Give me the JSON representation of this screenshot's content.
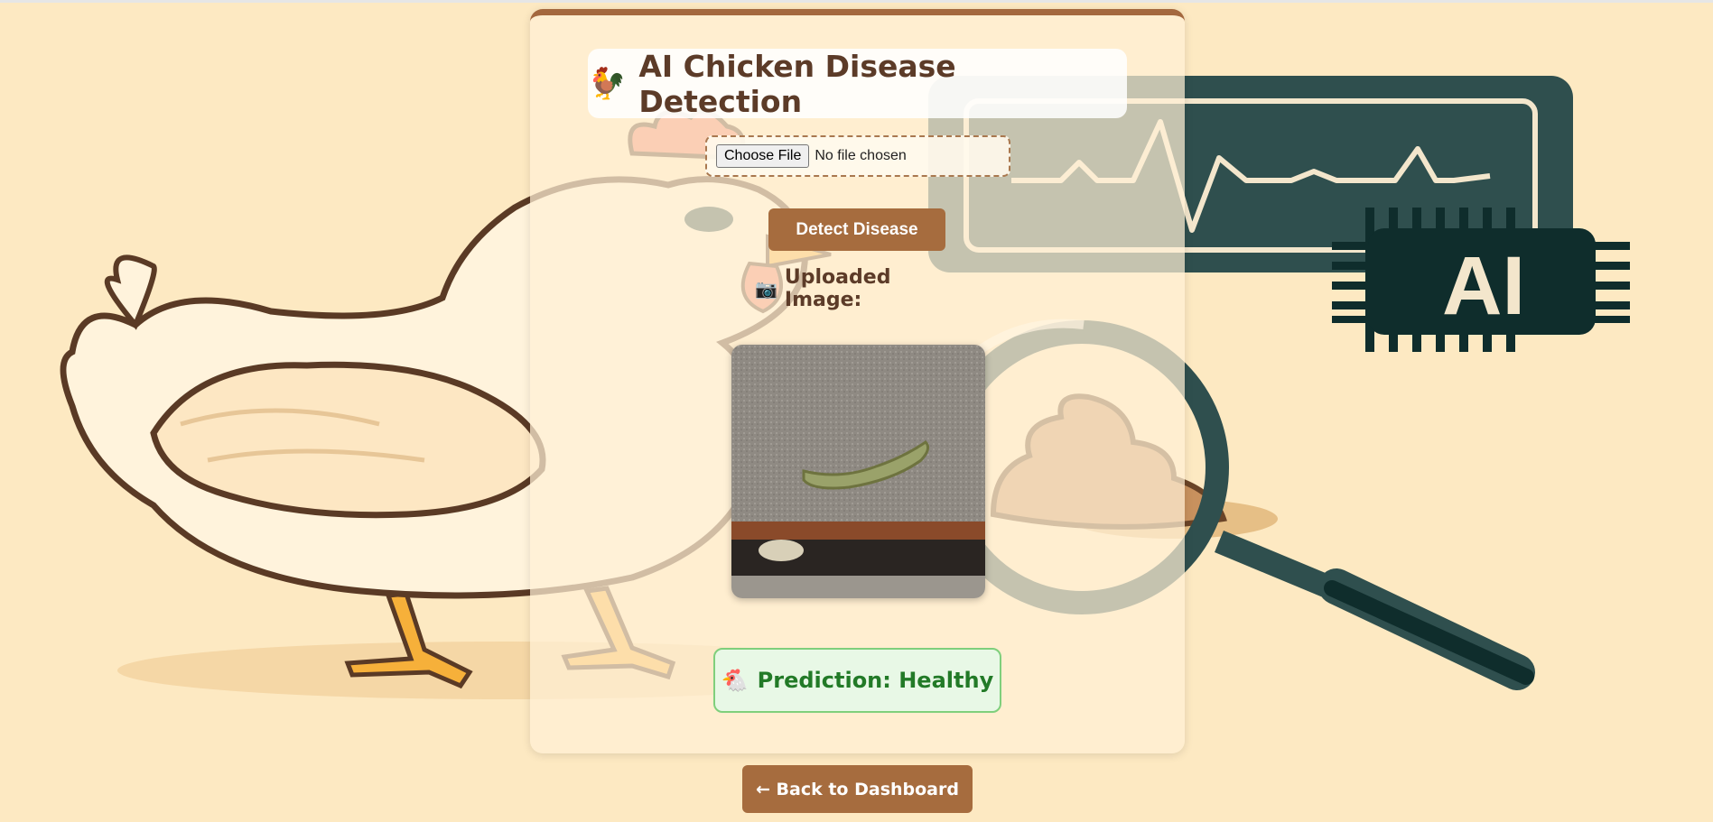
{
  "title": {
    "icon": "rooster-icon",
    "icon_glyph": "🐓",
    "text": "AI Chicken Disease Detection"
  },
  "upload": {
    "button_label": "Choose File",
    "status": "No file chosen"
  },
  "detect_button": "Detect Disease",
  "uploaded_image": {
    "icon": "camera-icon",
    "icon_glyph": "📷",
    "label": "Uploaded Image:"
  },
  "prediction": {
    "icon": "chicken-icon",
    "icon_glyph": "🐔",
    "text": "Prediction: Healthy"
  },
  "background_art": {
    "badge_text": "AI"
  },
  "back_button": "← Back to Dashboard",
  "colors": {
    "page_bg": "#fde9c2",
    "brand_brown": "#a66c3e",
    "title_text": "#5c3b28",
    "success_green": "#227a27",
    "success_bg": "#e8f8e6",
    "monitor_teal": "#2f4f4e"
  }
}
